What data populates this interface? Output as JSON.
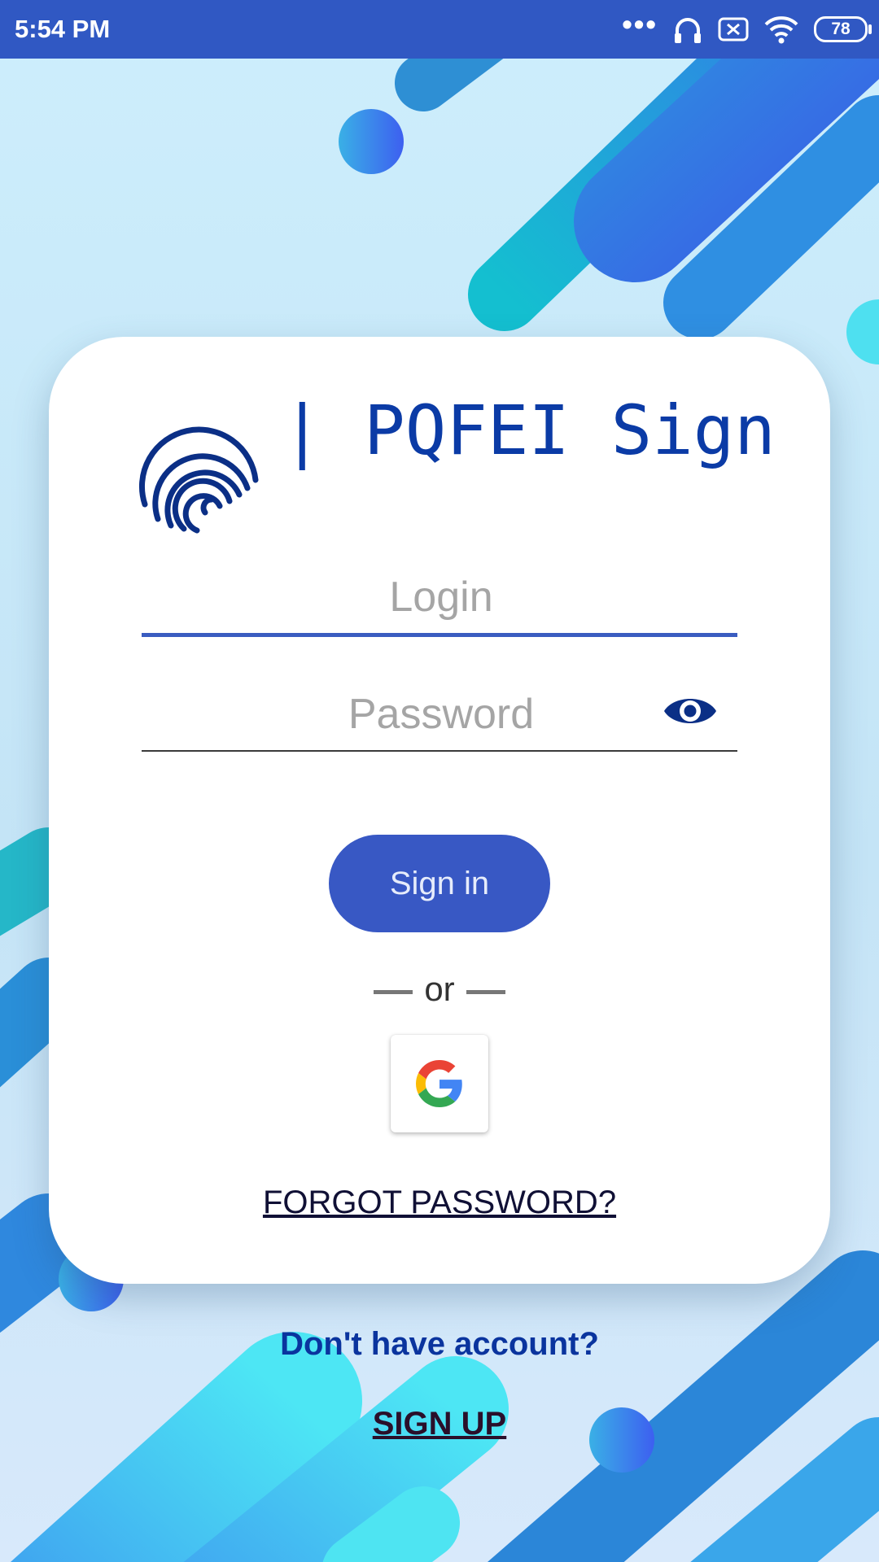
{
  "status_bar": {
    "time": "5:54 PM",
    "dots": "•••",
    "battery": "78",
    "icons": [
      "headphones-icon",
      "notification-off-icon",
      "wifi-icon",
      "battery-icon"
    ]
  },
  "brand": {
    "title": "| PQFEI Sign",
    "logo": "fingerprint-icon"
  },
  "login_field": {
    "placeholder": "Login",
    "value": ""
  },
  "password_field": {
    "placeholder": "Password",
    "value": "",
    "toggle_icon": "eye-icon"
  },
  "signin_label": "Sign in",
  "or_label": "or",
  "google_icon": "google-g-icon",
  "forgot_password": "FORGOT PASSWORD?",
  "no_account_text": "Don't have account?",
  "signup_label": "SIGN UP",
  "colors": {
    "status_bar": "#3058c3",
    "brand": "#0b3ba6",
    "primary_button": "#3858c4",
    "active_underline": "#3a5cc0"
  }
}
